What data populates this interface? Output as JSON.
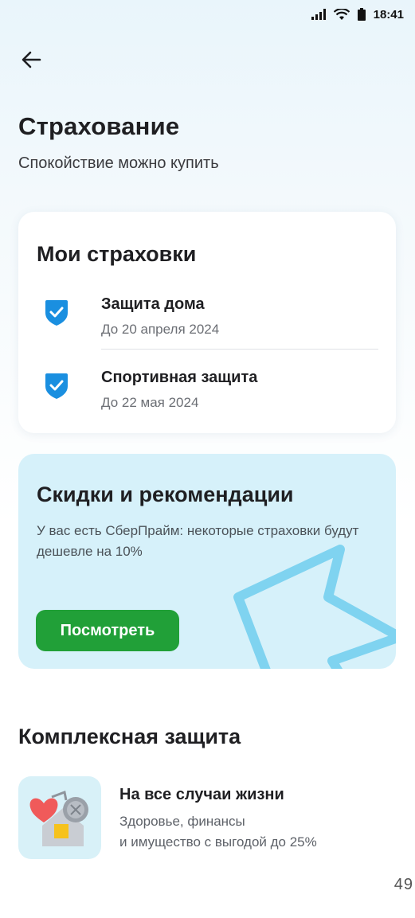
{
  "status_bar": {
    "time": "18:41"
  },
  "header": {
    "title": "Страхование",
    "subtitle": "Спокойствие можно купить"
  },
  "my_insurance": {
    "title": "Мои страховки",
    "items": [
      {
        "name": "Защита дома",
        "date": "До 20 апреля 2024"
      },
      {
        "name": "Спортивная защита",
        "date": "До 22 мая 2024"
      }
    ]
  },
  "promo": {
    "title": "Скидки и рекомендации",
    "text": "У вас есть СберПрайм: некоторые страховки будут дешевле на 10%",
    "button_label": "Посмотреть"
  },
  "complex": {
    "title": "Комплексная защита",
    "offer": {
      "name": "На все случаи жизни",
      "desc_line1": "Здоровье, финансы",
      "desc_line2": "и имущество с выгодой до 25%"
    }
  },
  "page_number": "49",
  "colors": {
    "accent_green": "#21a038",
    "shield_blue": "#1a8fe0",
    "promo_bg": "#d6f1fa"
  }
}
